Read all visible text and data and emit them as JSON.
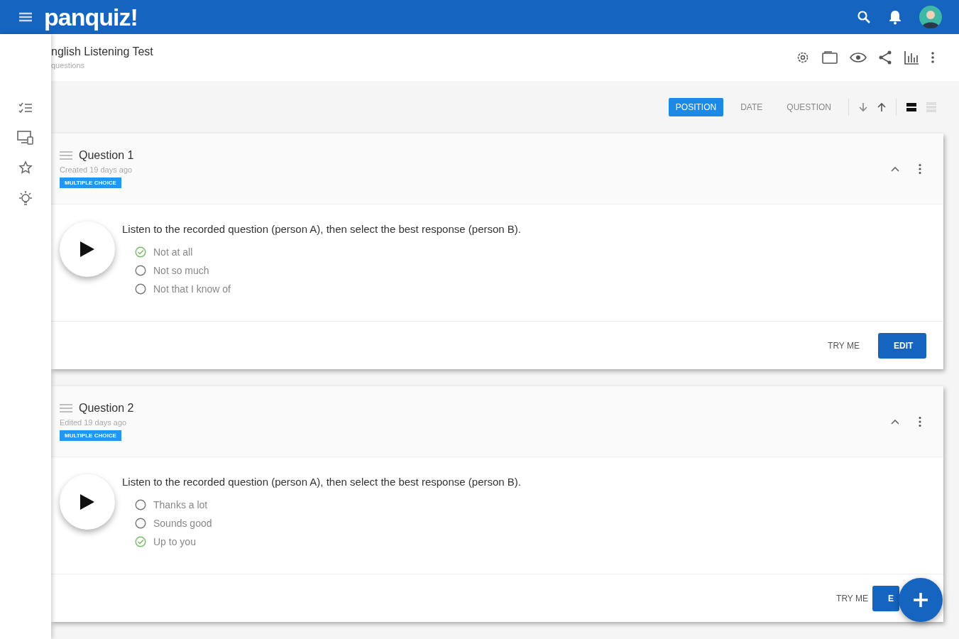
{
  "app_bar": {
    "logo": "panquiz!"
  },
  "quiz": {
    "title": "nglish Listening Test",
    "subtitle": "questions"
  },
  "sort_tabs": [
    {
      "label": "POSITION",
      "selected": true
    },
    {
      "label": "DATE",
      "selected": false
    },
    {
      "label": "QUESTION",
      "selected": false
    }
  ],
  "view_modes": [
    {
      "kind": "cards",
      "selected": true
    },
    {
      "kind": "list",
      "selected": false
    }
  ],
  "questions": [
    {
      "title": "Question 1",
      "meta": "Created 19 days ago",
      "tag": "MULTIPLE CHOICE",
      "prompt": "Listen to the recorded question (person A), then select the best response (person B).",
      "answers": [
        {
          "text": "Not at all",
          "correct": true
        },
        {
          "text": "Not so much",
          "correct": false
        },
        {
          "text": "Not that I know of",
          "correct": false
        }
      ],
      "try_label": "TRY ME",
      "edit_label": "EDIT"
    },
    {
      "title": "Question 2",
      "meta": "Edited 19 days ago",
      "tag": "MULTIPLE CHOICE",
      "prompt": "Listen to the recorded question (person A), then select the best response (person B).",
      "answers": [
        {
          "text": "Thanks a lot",
          "correct": false
        },
        {
          "text": "Sounds good",
          "correct": false
        },
        {
          "text": "Up to you",
          "correct": true
        }
      ],
      "try_label": "TRY ME",
      "edit_label": "E"
    }
  ]
}
